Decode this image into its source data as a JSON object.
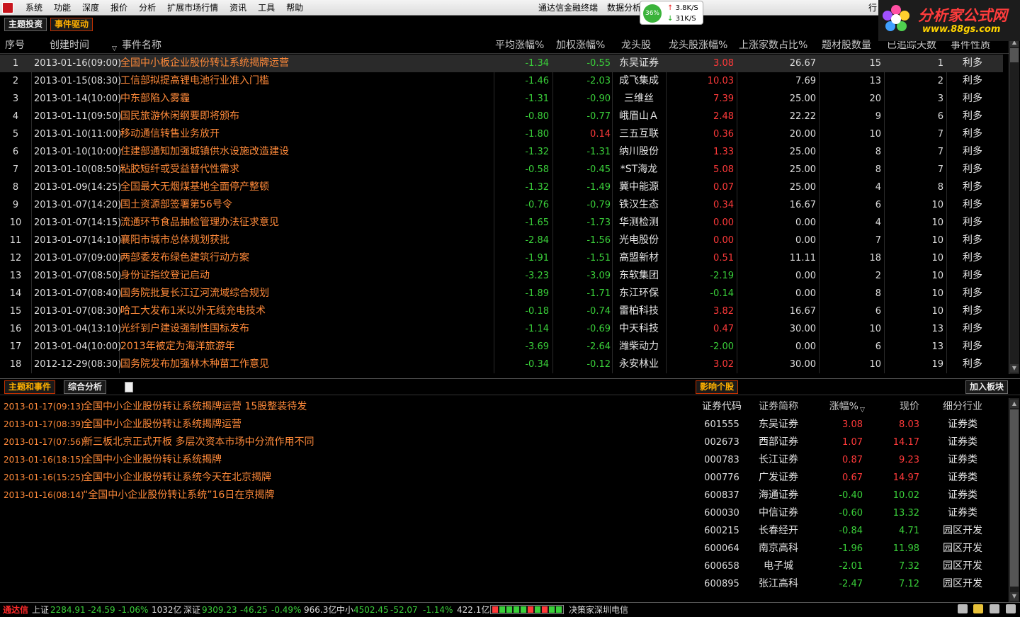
{
  "menubar": {
    "items": [
      "系统",
      "功能",
      "深度",
      "报价",
      "分析",
      "扩展市场行情",
      "资讯",
      "工具",
      "帮助"
    ],
    "terminal_title": "通达信金融终端",
    "data_analysis": "数据分析",
    "cpu": "36%",
    "up_speed": "3.8K/S",
    "down_speed": "31K/S",
    "right_menu": "行"
  },
  "brand": {
    "name": "分析家公式网",
    "url": "www.88gs.com"
  },
  "top_tabs": [
    "主题投资",
    "事件驱动"
  ],
  "grid": {
    "headers": [
      "序号",
      "创建时间",
      "事件名称",
      "平均涨幅%",
      "加权涨幅%",
      "龙头股",
      "龙头股涨幅%",
      "上涨家数占比%",
      "题材股数量",
      "已追踪天数",
      "事件性质"
    ],
    "rows": [
      [
        "1",
        "2013-01-16(09:00)",
        "全国中小板企业股份转让系统揭牌运营",
        "-1.34",
        "-0.55",
        "东吴证券",
        "3.08",
        "26.67",
        "15",
        "1",
        "利多"
      ],
      [
        "2",
        "2013-01-15(08:30)",
        "工信部拟提高锂电池行业准入门槛",
        "-1.46",
        "-2.03",
        "成飞集成",
        "10.03",
        "7.69",
        "13",
        "2",
        "利多"
      ],
      [
        "3",
        "2013-01-14(10:00)",
        "中东部陷入雾霾",
        "-1.31",
        "-0.90",
        "三维丝",
        "7.39",
        "25.00",
        "20",
        "3",
        "利多"
      ],
      [
        "4",
        "2013-01-11(09:50)",
        "国民旅游休闲纲要即将颁布",
        "-0.80",
        "-0.77",
        "峨眉山Ａ",
        "2.48",
        "22.22",
        "9",
        "6",
        "利多"
      ],
      [
        "5",
        "2013-01-10(11:00)",
        "移动通信转售业务放开",
        "-1.80",
        "0.14",
        "三五互联",
        "0.36",
        "20.00",
        "10",
        "7",
        "利多"
      ],
      [
        "6",
        "2013-01-10(10:00)",
        "住建部通知加强城镇供水设施改造建设",
        "-1.32",
        "-1.31",
        "纳川股份",
        "1.33",
        "25.00",
        "8",
        "7",
        "利多"
      ],
      [
        "7",
        "2013-01-10(08:50)",
        "粘胶短纤或受益替代性需求",
        "-0.58",
        "-0.45",
        "*ST海龙",
        "5.08",
        "25.00",
        "8",
        "7",
        "利多"
      ],
      [
        "8",
        "2013-01-09(14:25)",
        "全国最大无烟煤基地全面停产整顿",
        "-1.32",
        "-1.49",
        "冀中能源",
        "0.07",
        "25.00",
        "4",
        "8",
        "利多"
      ],
      [
        "9",
        "2013-01-07(14:20)",
        "国土资源部签署第56号令",
        "-0.76",
        "-0.79",
        "铁汉生态",
        "0.34",
        "16.67",
        "6",
        "10",
        "利多"
      ],
      [
        "10",
        "2013-01-07(14:15)",
        "流通环节食品抽检管理办法征求意见",
        "-1.65",
        "-1.73",
        "华测检测",
        "0.00",
        "0.00",
        "4",
        "10",
        "利多"
      ],
      [
        "11",
        "2013-01-07(14:10)",
        "襄阳市城市总体规划获批",
        "-2.84",
        "-1.56",
        "光电股份",
        "0.00",
        "0.00",
        "7",
        "10",
        "利多"
      ],
      [
        "12",
        "2013-01-07(09:00)",
        "两部委发布绿色建筑行动方案",
        "-1.91",
        "-1.51",
        "高盟新材",
        "0.51",
        "11.11",
        "18",
        "10",
        "利多"
      ],
      [
        "13",
        "2013-01-07(08:50)",
        "身份证指纹登记启动",
        "-3.23",
        "-3.09",
        "东软集团",
        "-2.19",
        "0.00",
        "2",
        "10",
        "利多"
      ],
      [
        "14",
        "2013-01-07(08:40)",
        "国务院批复长江辽河流域综合规划",
        "-1.89",
        "-1.71",
        "东江环保",
        "-0.14",
        "0.00",
        "8",
        "10",
        "利多"
      ],
      [
        "15",
        "2013-01-07(08:30)",
        "哈工大发布1米以外无线充电技术",
        "-0.18",
        "-0.74",
        "雷柏科技",
        "3.82",
        "16.67",
        "6",
        "10",
        "利多"
      ],
      [
        "16",
        "2013-01-04(13:10)",
        "光纤到户建设强制性国标发布",
        "-1.14",
        "-0.69",
        "中天科技",
        "0.47",
        "30.00",
        "10",
        "13",
        "利多"
      ],
      [
        "17",
        "2013-01-04(10:00)",
        "2013年被定为海洋旅游年",
        "-3.69",
        "-2.64",
        "潍柴动力",
        "-2.00",
        "0.00",
        "6",
        "13",
        "利多"
      ],
      [
        "18",
        "2012-12-29(08:30)",
        "国务院发布加强林木种苗工作意见",
        "-0.34",
        "-0.12",
        "永安林业",
        "3.02",
        "30.00",
        "10",
        "19",
        "利多"
      ]
    ]
  },
  "bottom_tabs": {
    "left": [
      "主题和事件",
      "综合分析"
    ],
    "mid": "影响个股",
    "right": "加入板块"
  },
  "news": [
    {
      "time": "2013-01-17(09:13)",
      "title": "全国中小企业股份转让系统揭牌运营 15股整装待发"
    },
    {
      "time": "2013-01-17(08:39)",
      "title": "全国中小企业股份转让系统揭牌运营"
    },
    {
      "time": "2013-01-17(07:56)",
      "title": "新三板北京正式开板 多层次资本市场中分流作用不同"
    },
    {
      "time": "2013-01-16(18:15)",
      "title": "全国中小企业股份转让系统揭牌"
    },
    {
      "time": "2013-01-16(15:25)",
      "title": "全国中小企业股份转让系统今天在北京揭牌"
    },
    {
      "time": "2013-01-16(08:14)",
      "title": "“全国中小企业股份转让系统”16日在京揭牌"
    }
  ],
  "stocks": {
    "headers": [
      "证券代码",
      "证券简称",
      "涨幅%",
      "现价",
      "细分行业"
    ],
    "rows": [
      [
        "601555",
        "东吴证券",
        "3.08",
        "8.03",
        "证券类"
      ],
      [
        "002673",
        "西部证券",
        "1.07",
        "14.17",
        "证券类"
      ],
      [
        "000783",
        "长江证券",
        "0.87",
        "9.23",
        "证券类"
      ],
      [
        "000776",
        "广发证券",
        "0.67",
        "14.97",
        "证券类"
      ],
      [
        "600837",
        "海通证券",
        "-0.40",
        "10.02",
        "证券类"
      ],
      [
        "600030",
        "中信证券",
        "-0.60",
        "13.32",
        "证券类"
      ],
      [
        "600215",
        "长春经开",
        "-0.84",
        "4.71",
        "园区开发"
      ],
      [
        "600064",
        "南京高科",
        "-1.96",
        "11.98",
        "园区开发"
      ],
      [
        "600658",
        "电子城",
        "-2.01",
        "7.32",
        "园区开发"
      ],
      [
        "600895",
        "张江高科",
        "-2.47",
        "7.12",
        "园区开发"
      ]
    ]
  },
  "statusbar": {
    "brand": "通达信",
    "sh_label": "上证",
    "sh_val": "2284.91",
    "sh_chg": "-24.59",
    "sh_pct": "-1.06%",
    "sh_vol": "1032亿",
    "sz_label": "深证",
    "sz_val": "9309.23",
    "sz_chg": "-46.25",
    "sz_pct": "-0.49%",
    "sz_vol": "966.3亿",
    "zx_label": "中小",
    "zx_val": "4502.45",
    "zx_chg": "-52.07",
    "zx_pct": "-1.14%",
    "zx_vol": "422.1亿",
    "broker": "决策家深圳电信"
  },
  "colors": {
    "up": "#ff3a3a",
    "down": "#3ad03a",
    "accent": "#ff8a3a",
    "bg": "#000000"
  }
}
